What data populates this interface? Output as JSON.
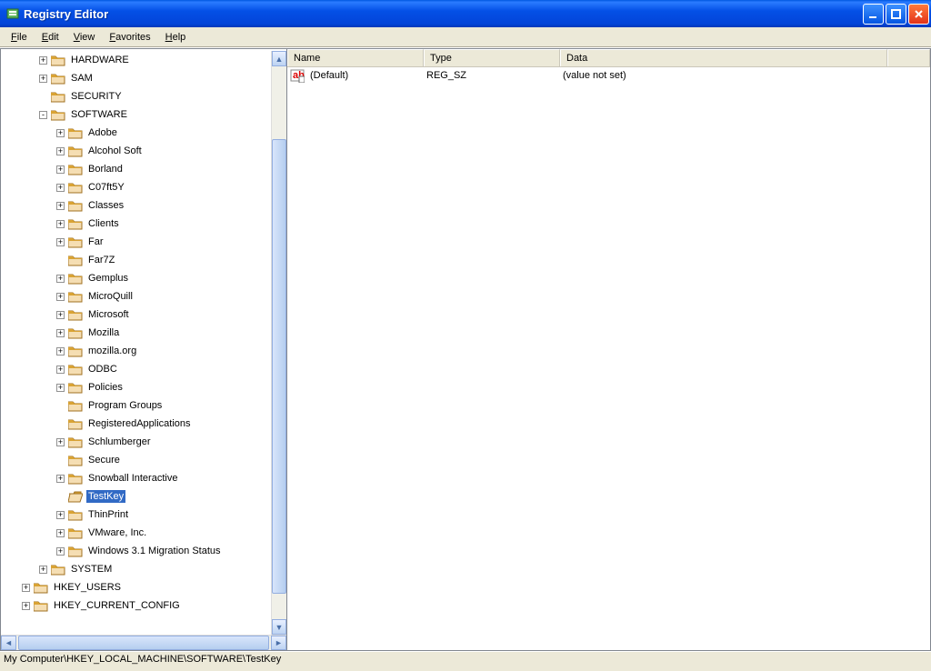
{
  "window": {
    "title": "Registry Editor"
  },
  "menu": {
    "file": "File",
    "edit": "Edit",
    "view": "View",
    "favorites": "Favorites",
    "help": "Help"
  },
  "tree": [
    {
      "indent": 2,
      "exp": "+",
      "label": "HARDWARE"
    },
    {
      "indent": 2,
      "exp": "+",
      "label": "SAM"
    },
    {
      "indent": 2,
      "exp": "",
      "label": "SECURITY"
    },
    {
      "indent": 2,
      "exp": "-",
      "label": "SOFTWARE"
    },
    {
      "indent": 3,
      "exp": "+",
      "label": "Adobe"
    },
    {
      "indent": 3,
      "exp": "+",
      "label": "Alcohol Soft"
    },
    {
      "indent": 3,
      "exp": "+",
      "label": "Borland"
    },
    {
      "indent": 3,
      "exp": "+",
      "label": "C07ft5Y"
    },
    {
      "indent": 3,
      "exp": "+",
      "label": "Classes"
    },
    {
      "indent": 3,
      "exp": "+",
      "label": "Clients"
    },
    {
      "indent": 3,
      "exp": "+",
      "label": "Far"
    },
    {
      "indent": 3,
      "exp": "",
      "label": "Far7Z"
    },
    {
      "indent": 3,
      "exp": "+",
      "label": "Gemplus"
    },
    {
      "indent": 3,
      "exp": "+",
      "label": "MicroQuill"
    },
    {
      "indent": 3,
      "exp": "+",
      "label": "Microsoft"
    },
    {
      "indent": 3,
      "exp": "+",
      "label": "Mozilla"
    },
    {
      "indent": 3,
      "exp": "+",
      "label": "mozilla.org"
    },
    {
      "indent": 3,
      "exp": "+",
      "label": "ODBC"
    },
    {
      "indent": 3,
      "exp": "+",
      "label": "Policies"
    },
    {
      "indent": 3,
      "exp": "",
      "label": "Program Groups"
    },
    {
      "indent": 3,
      "exp": "",
      "label": "RegisteredApplications"
    },
    {
      "indent": 3,
      "exp": "+",
      "label": "Schlumberger"
    },
    {
      "indent": 3,
      "exp": "",
      "label": "Secure"
    },
    {
      "indent": 3,
      "exp": "+",
      "label": "Snowball Interactive"
    },
    {
      "indent": 3,
      "exp": "",
      "label": "TestKey",
      "selected": true,
      "open": true
    },
    {
      "indent": 3,
      "exp": "+",
      "label": "ThinPrint"
    },
    {
      "indent": 3,
      "exp": "+",
      "label": "VMware, Inc."
    },
    {
      "indent": 3,
      "exp": "+",
      "label": "Windows 3.1 Migration Status"
    },
    {
      "indent": 2,
      "exp": "+",
      "label": "SYSTEM"
    },
    {
      "indent": 1,
      "exp": "+",
      "label": "HKEY_USERS"
    },
    {
      "indent": 1,
      "exp": "+",
      "label": "HKEY_CURRENT_CONFIG"
    }
  ],
  "list": {
    "headers": {
      "name": "Name",
      "type": "Type",
      "data": "Data"
    },
    "rows": [
      {
        "name": "(Default)",
        "type": "REG_SZ",
        "data": "(value not set)"
      }
    ]
  },
  "statusbar": "My Computer\\HKEY_LOCAL_MACHINE\\SOFTWARE\\TestKey"
}
